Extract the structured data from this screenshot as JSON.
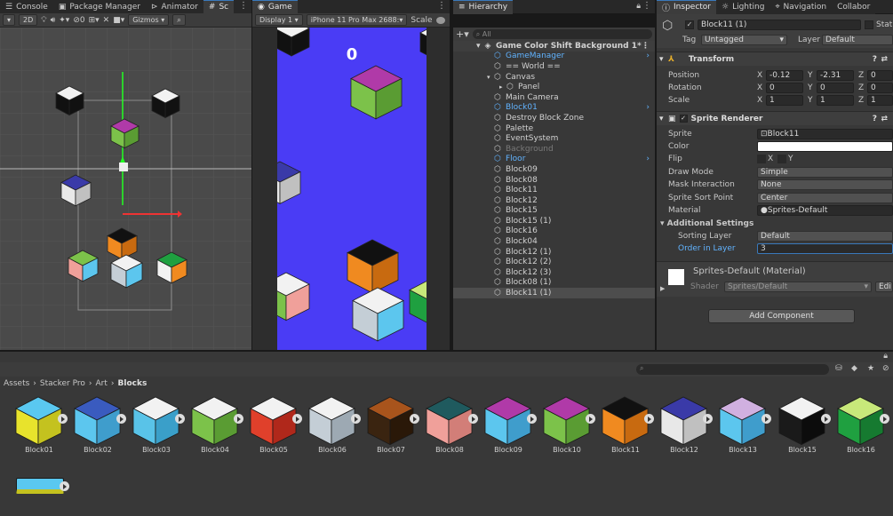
{
  "tabs_left": [
    {
      "label": "Console",
      "icon": "console-icon"
    },
    {
      "label": "Package Manager",
      "icon": "package-icon"
    },
    {
      "label": "Animator",
      "icon": "animator-icon"
    },
    {
      "label": "Sc",
      "icon": "scene-icon"
    }
  ],
  "game_tab": {
    "label": "Game"
  },
  "hier_tab": {
    "label": "Hierarchy"
  },
  "insp_tabs": [
    {
      "label": "Inspector"
    },
    {
      "label": "Lighting"
    },
    {
      "label": "Navigation"
    },
    {
      "label": "Collabor"
    }
  ],
  "scene_toolbar": {
    "two_d": "2D",
    "layers_count": "0",
    "gizmos": "Gizmos"
  },
  "game_toolbar": {
    "display": "Display 1",
    "device": "iPhone 11 Pro Max",
    "res": "2688:",
    "scale": "Scale"
  },
  "game_score": "0",
  "hierarchy": {
    "search_placeholder": "All",
    "scene": "Game Color Shift Background 1*",
    "items": [
      {
        "label": "GameManager",
        "indent": 1,
        "style": "blue",
        "arrow": true
      },
      {
        "label": "== World ==",
        "indent": 1,
        "style": "",
        "arrow": false
      },
      {
        "label": "Canvas",
        "indent": 1,
        "style": "",
        "expand": "down"
      },
      {
        "label": "Panel",
        "indent": 2,
        "style": "",
        "expand": "right"
      },
      {
        "label": "Main Camera",
        "indent": 1,
        "style": ""
      },
      {
        "label": "Block01",
        "indent": 1,
        "style": "blue",
        "arrow": true
      },
      {
        "label": "Destroy Block Zone",
        "indent": 1,
        "style": ""
      },
      {
        "label": "Palette",
        "indent": 1,
        "style": ""
      },
      {
        "label": "EventSystem",
        "indent": 1,
        "style": ""
      },
      {
        "label": "Background",
        "indent": 1,
        "style": "dim"
      },
      {
        "label": "Floor",
        "indent": 1,
        "style": "blue",
        "arrow": true
      },
      {
        "label": "Block09",
        "indent": 1,
        "style": ""
      },
      {
        "label": "Block08",
        "indent": 1,
        "style": ""
      },
      {
        "label": "Block11",
        "indent": 1,
        "style": ""
      },
      {
        "label": "Block12",
        "indent": 1,
        "style": ""
      },
      {
        "label": "Block15",
        "indent": 1,
        "style": ""
      },
      {
        "label": "Block15 (1)",
        "indent": 1,
        "style": ""
      },
      {
        "label": "Block16",
        "indent": 1,
        "style": ""
      },
      {
        "label": "Block04",
        "indent": 1,
        "style": ""
      },
      {
        "label": "Block12 (1)",
        "indent": 1,
        "style": ""
      },
      {
        "label": "Block12 (2)",
        "indent": 1,
        "style": ""
      },
      {
        "label": "Block12 (3)",
        "indent": 1,
        "style": ""
      },
      {
        "label": "Block08 (1)",
        "indent": 1,
        "style": ""
      },
      {
        "label": "Block11 (1)",
        "indent": 1,
        "style": "sel"
      }
    ]
  },
  "inspector": {
    "object_name": "Block11 (1)",
    "static": "Stati",
    "tag_label": "Tag",
    "tag": "Untagged",
    "layer_label": "Layer",
    "layer": "Default",
    "transform": {
      "title": "Transform",
      "position_label": "Position",
      "px": "-0.12",
      "py": "-2.31",
      "pz": "0",
      "rotation_label": "Rotation",
      "rx": "0",
      "ry": "0",
      "rz": "0",
      "scale_label": "Scale",
      "sx": "1",
      "sy": "1",
      "sz": "1"
    },
    "axes": {
      "x": "X",
      "y": "Y",
      "z": "Z"
    },
    "sprite_renderer": {
      "title": "Sprite Renderer",
      "sprite_label": "Sprite",
      "sprite": "Block11",
      "color_label": "Color",
      "flip_label": "Flip",
      "flip_x": "X",
      "flip_y": "Y",
      "draw_mode_label": "Draw Mode",
      "draw_mode": "Simple",
      "mask_label": "Mask Interaction",
      "mask": "None",
      "sort_point_label": "Sprite Sort Point",
      "sort_point": "Center",
      "material_label": "Material",
      "material": "Sprites-Default",
      "additional_label": "Additional Settings",
      "sorting_layer_label": "Sorting Layer",
      "sorting_layer": "Default",
      "order_label": "Order in Layer",
      "order": "3"
    },
    "material_block": {
      "title": "Sprites-Default (Material)",
      "shader_label": "Shader",
      "shader": "Sprites/Default",
      "edit": "Edi"
    },
    "add_component": "Add Component"
  },
  "project": {
    "breadcrumb": [
      "Assets",
      "Stacker Pro",
      "Art",
      "Blocks"
    ],
    "assets": [
      {
        "name": "Block01",
        "top": "#5ac8f0",
        "left": "#e8e32c",
        "right": "#c4c21f"
      },
      {
        "name": "Block02",
        "top": "#3a5bbf",
        "left": "#5cc6ee",
        "right": "#3f9dcc"
      },
      {
        "name": "Block03",
        "top": "#f2f2f2",
        "left": "#59c3e8",
        "right": "#3a9fc9"
      },
      {
        "name": "Block04",
        "top": "#f2f2f2",
        "left": "#7cc24a",
        "right": "#5a9c33"
      },
      {
        "name": "Block05",
        "top": "#f2f2f2",
        "left": "#e0402b",
        "right": "#b0281b"
      },
      {
        "name": "Block06",
        "top": "#f2f2f2",
        "left": "#c4ced6",
        "right": "#9da9b3"
      },
      {
        "name": "Block07",
        "top": "#a8541c",
        "left": "#3a2410",
        "right": "#2a1808"
      },
      {
        "name": "Block08",
        "top": "#1f5a5e",
        "left": "#f0a09a",
        "right": "#d27e78"
      },
      {
        "name": "Block09",
        "top": "#b03aa8",
        "left": "#5cc6ee",
        "right": "#3f9dcc"
      },
      {
        "name": "Block10",
        "top": "#b03aa8",
        "left": "#7cc24a",
        "right": "#5a9c33"
      },
      {
        "name": "Block11",
        "top": "#111111",
        "left": "#f08a20",
        "right": "#c86a10"
      },
      {
        "name": "Block12",
        "top": "#3a3aa8",
        "left": "#e8e8e8",
        "right": "#c0c0c0"
      },
      {
        "name": "Block13",
        "top": "#d0b0e0",
        "left": "#5cc6ee",
        "right": "#3f9dcc"
      },
      {
        "name": "Block15",
        "top": "#f2f2f2",
        "left": "#1a1a1a",
        "right": "#0c0c0c"
      },
      {
        "name": "Block16",
        "top": "#c8e87a",
        "left": "#1fa040",
        "right": "#167a30"
      }
    ]
  },
  "colors": {
    "game_bg": "#4a3cf5",
    "selection": "#3a79bb",
    "blue_text": "#61b3ff"
  }
}
